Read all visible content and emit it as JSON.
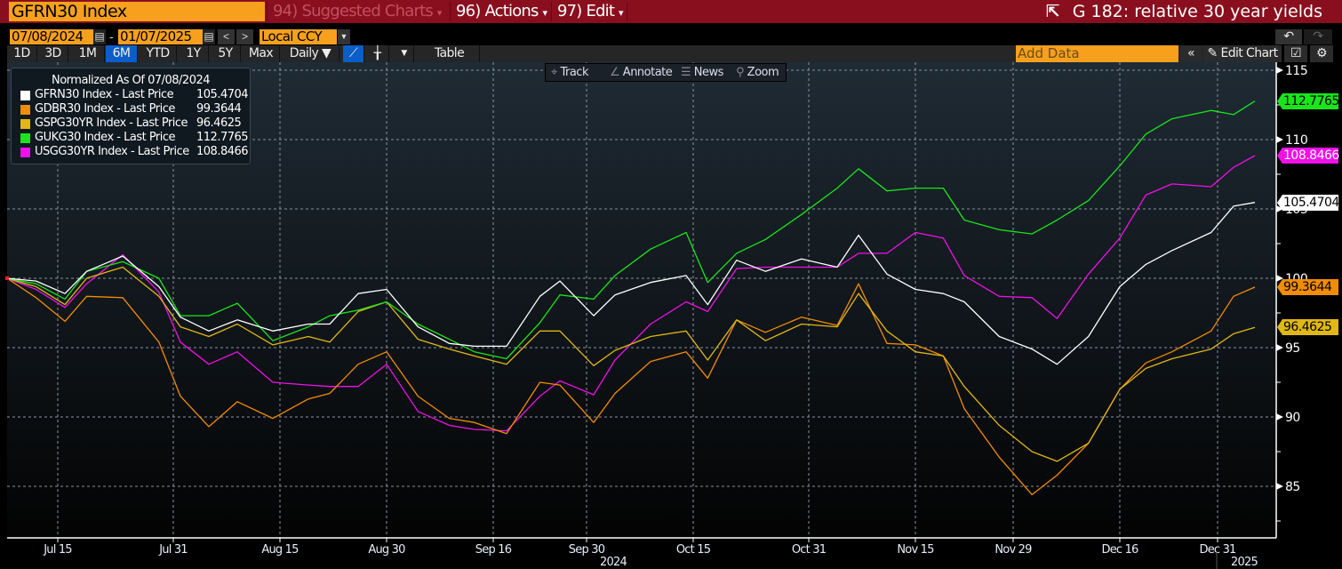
{
  "header": {
    "ticker": "GFRN30 Index",
    "suggested": "94) Suggested Charts",
    "actions": "96) Actions",
    "edit": "97) Edit",
    "title": "G 182: relative 30 year yields",
    "launch_icon": "external-link-icon",
    "bar_color": "#8a0f1e"
  },
  "range": {
    "start": "07/08/2024",
    "end": "01/07/2025",
    "currency": "Local CCY"
  },
  "periods": [
    {
      "label": "1D"
    },
    {
      "label": "3D"
    },
    {
      "label": "1M"
    },
    {
      "label": "6M",
      "active": true
    },
    {
      "label": "YTD"
    },
    {
      "label": "1Y"
    },
    {
      "label": "5Y"
    },
    {
      "label": "Max"
    }
  ],
  "frequency": "Daily ▼",
  "table_label": "Table",
  "add_data_placeholder": "Add Data",
  "edit_chart": "Edit Chart",
  "tools": {
    "track": "Track",
    "annotate": "Annotate",
    "news": "News",
    "zoom": "Zoom"
  },
  "chart_data": {
    "type": "line",
    "title": "",
    "legend_title": "Normalized As Of 07/08/2024",
    "legend_placement": "top-left",
    "grid": true,
    "ylim": [
      82,
      116
    ],
    "y_ticks": [
      "115",
      "110",
      "105",
      "100",
      "95",
      "90",
      "85"
    ],
    "x_ticks": [
      "Jul 15",
      "Jul 31",
      "Aug 15",
      "Aug 30",
      "Sep 16",
      "Sep 30",
      "Oct 15",
      "Oct 31",
      "Nov 15",
      "Nov 29",
      "Dec 16",
      "Dec 31"
    ],
    "x_years": [
      "2024",
      "2025"
    ],
    "x": [
      "2024-07-08",
      "2024-07-12",
      "2024-07-16",
      "2024-07-19",
      "2024-07-24",
      "2024-07-29",
      "2024-08-01",
      "2024-08-05",
      "2024-08-09",
      "2024-08-14",
      "2024-08-19",
      "2024-08-22",
      "2024-08-26",
      "2024-08-30",
      "2024-09-04",
      "2024-09-09",
      "2024-09-13",
      "2024-09-18",
      "2024-09-23",
      "2024-09-26",
      "2024-10-01",
      "2024-10-04",
      "2024-10-09",
      "2024-10-14",
      "2024-10-17",
      "2024-10-21",
      "2024-10-25",
      "2024-10-30",
      "2024-11-04",
      "2024-11-07",
      "2024-11-11",
      "2024-11-15",
      "2024-11-19",
      "2024-11-22",
      "2024-11-27",
      "2024-12-02",
      "2024-12-06",
      "2024-12-11",
      "2024-12-16",
      "2024-12-20",
      "2024-12-24",
      "2024-12-30",
      "2025-01-03",
      "2025-01-07"
    ],
    "series": [
      {
        "name": "GFRN30 Index - Last Price",
        "last": "105.4704",
        "color": "#ffffff",
        "tag_text": "#000000",
        "values": [
          100,
          99.8,
          98.9,
          100.5,
          101.6,
          99.4,
          97.2,
          96.2,
          97.0,
          96.2,
          96.7,
          96.7,
          98.9,
          99.2,
          96.5,
          95.3,
          95.1,
          95.1,
          98.7,
          99.8,
          97.3,
          98.8,
          99.7,
          100.2,
          98.1,
          101.3,
          100.5,
          101.4,
          100.8,
          103.1,
          100.3,
          99.2,
          98.9,
          98.3,
          95.8,
          94.9,
          93.8,
          95.8,
          99.4,
          101.0,
          102.0,
          103.3,
          105.2,
          105.4704
        ]
      },
      {
        "name": "GDBR30 Index - Last Price",
        "last": "99.3644",
        "color": "#f28c00",
        "tag_text": "#000000",
        "values": [
          100,
          98.6,
          96.9,
          98.7,
          98.6,
          95.4,
          91.5,
          89.3,
          91.1,
          89.9,
          91.3,
          91.7,
          93.8,
          94.7,
          91.5,
          89.9,
          89.6,
          88.8,
          92.5,
          92.3,
          89.6,
          91.7,
          94.0,
          94.7,
          92.8,
          97.0,
          96.1,
          97.2,
          96.6,
          99.6,
          95.3,
          95.2,
          94.4,
          90.6,
          87.1,
          84.4,
          85.8,
          88.1,
          92.0,
          93.9,
          94.7,
          96.2,
          98.7,
          99.3644
        ]
      },
      {
        "name": "GSPG30YR Index - Last Price",
        "last": "96.4625",
        "color": "#e0b814",
        "tag_text": "#000000",
        "values": [
          100,
          99.4,
          98.1,
          100,
          100.8,
          98.7,
          96.5,
          95.8,
          96.7,
          95.2,
          95.8,
          95.4,
          97.6,
          98.3,
          95.6,
          94.9,
          94.4,
          93.8,
          96.2,
          96.2,
          93.7,
          94.8,
          95.8,
          96.2,
          94.1,
          97.0,
          95.5,
          96.7,
          96.5,
          98.9,
          96.2,
          94.7,
          94.4,
          92.2,
          89.4,
          87.5,
          86.8,
          88.1,
          92.0,
          93.5,
          94.2,
          94.9,
          96.0,
          96.4625
        ]
      },
      {
        "name": "GUKG30 Index - Last Price",
        "last": "112.7765",
        "color": "#19e619",
        "tag_text": "#000000",
        "values": [
          100,
          99.6,
          98.5,
          100.5,
          101.2,
          100,
          97.3,
          97.3,
          98.2,
          95.5,
          96.5,
          97.3,
          97.7,
          98.3,
          96.7,
          95.6,
          94.7,
          94.2,
          96.8,
          98.8,
          98.5,
          100.2,
          102.1,
          103.3,
          99.7,
          101.8,
          102.8,
          104.6,
          106.5,
          107.9,
          106.3,
          106.5,
          106.5,
          104.2,
          103.5,
          103.2,
          104.2,
          105.6,
          108.1,
          110.4,
          111.5,
          112.1,
          111.8,
          112.7765
        ]
      },
      {
        "name": "USGG30YR Index - Last Price",
        "last": "108.8466",
        "color": "#f010e8",
        "tag_text": "#ffffff",
        "values": [
          100,
          99.2,
          97.9,
          99.6,
          101.7,
          99.0,
          95.4,
          93.8,
          94.7,
          92.5,
          92.3,
          92.2,
          92.2,
          93.8,
          90.4,
          89.4,
          89.1,
          89.0,
          91.5,
          92.6,
          91.6,
          94.1,
          96.7,
          98.3,
          97.6,
          100.7,
          100.8,
          100.8,
          100.8,
          101.8,
          101.8,
          103.3,
          102.9,
          100.2,
          98.7,
          98.6,
          97.1,
          100.3,
          102.9,
          106.0,
          106.8,
          106.6,
          108.0,
          108.8466
        ]
      }
    ]
  }
}
